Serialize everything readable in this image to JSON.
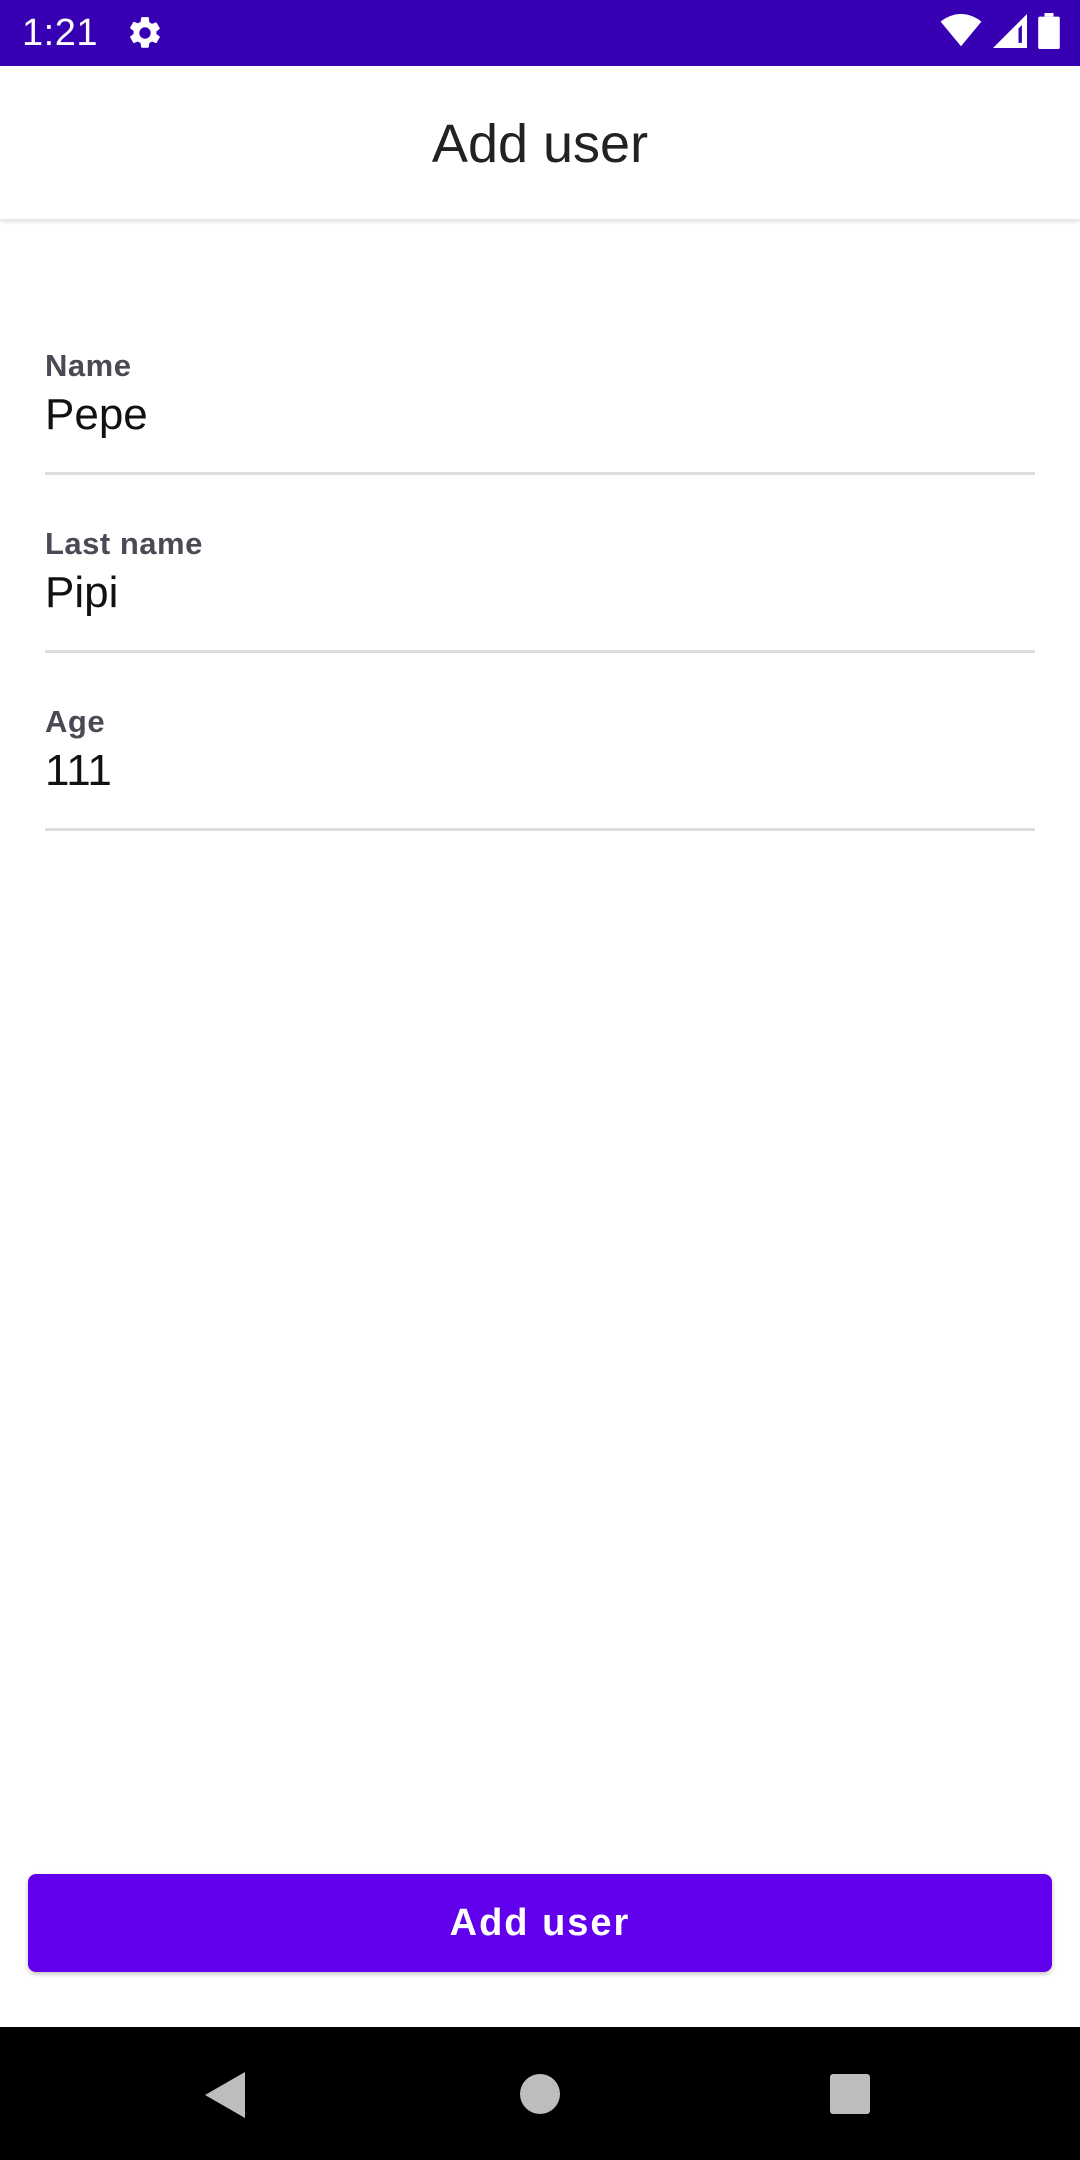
{
  "status_bar": {
    "time": "1:21",
    "settings_icon": "gear-icon",
    "wifi_icon": "wifi-icon",
    "signal_icon": "signal-icon",
    "battery_icon": "battery-icon",
    "background_color": "#3700b3"
  },
  "app_bar": {
    "title": "Add user"
  },
  "form": {
    "fields": [
      {
        "label": "Name",
        "value": "Pepe"
      },
      {
        "label": "Last name",
        "value": "Pipi"
      },
      {
        "label": "Age",
        "value": "111"
      }
    ]
  },
  "actions": {
    "submit_label": "Add user",
    "accent_color": "#6200ee"
  },
  "nav_bar": {
    "back_icon": "back-triangle-icon",
    "home_icon": "home-circle-icon",
    "recents_icon": "recents-square-icon"
  }
}
